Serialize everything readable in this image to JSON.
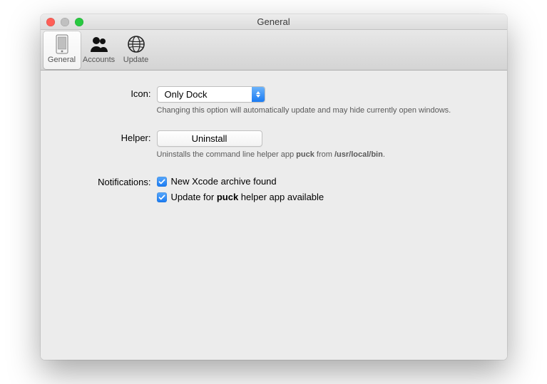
{
  "window": {
    "title": "General"
  },
  "toolbar": {
    "items": [
      {
        "label": "General",
        "selected": true
      },
      {
        "label": "Accounts",
        "selected": false
      },
      {
        "label": "Update",
        "selected": false
      }
    ]
  },
  "form": {
    "icon": {
      "label": "Icon:",
      "value": "Only Dock",
      "hint": "Changing this option will automatically update and may hide currently open windows."
    },
    "helper": {
      "label": "Helper:",
      "button": "Uninstall",
      "hint_prefix": "Uninstalls the command line helper app ",
      "hint_app": "puck",
      "hint_mid": " from ",
      "hint_path": "/usr/local/bin",
      "hint_suffix": "."
    },
    "notifications": {
      "label": "Notifications:",
      "items": [
        {
          "checked": true,
          "text": "New Xcode archive found"
        },
        {
          "checked": true,
          "pre": "Update for ",
          "bold": "puck",
          "post": " helper app available"
        }
      ]
    }
  }
}
